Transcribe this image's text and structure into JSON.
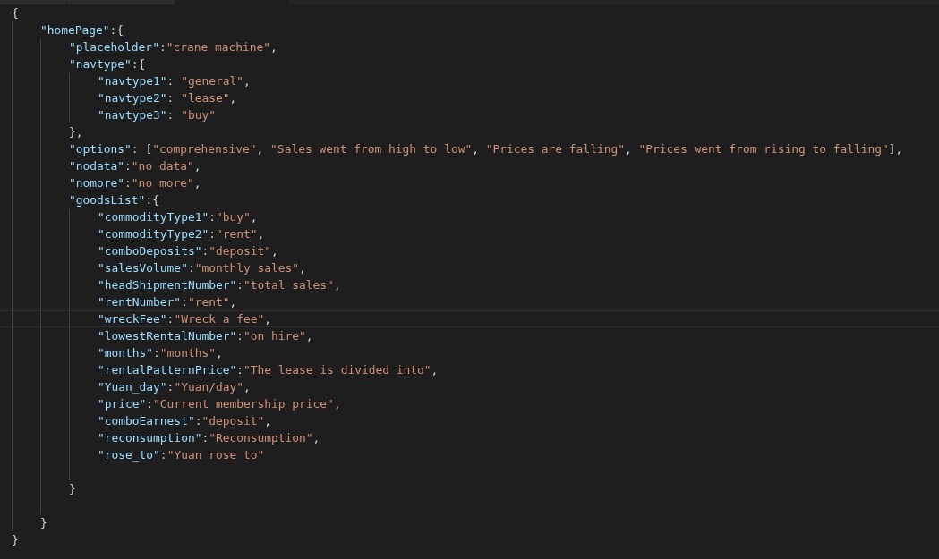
{
  "editor": {
    "lines": [
      {
        "current": false,
        "tokens": [
          {
            "kind": "punct",
            "text": "{"
          }
        ],
        "children": [
          {
            "current": false,
            "tokens": [
              {
                "kind": "key",
                "text": "\"homePage\""
              },
              {
                "kind": "punct",
                "text": ":{"
              }
            ],
            "children": [
              {
                "current": false,
                "tokens": [
                  {
                    "kind": "key",
                    "text": "\"placeholder\""
                  },
                  {
                    "kind": "punct",
                    "text": ":"
                  },
                  {
                    "kind": "str",
                    "text": "\"crane machine\""
                  },
                  {
                    "kind": "punct",
                    "text": ","
                  }
                ]
              },
              {
                "current": false,
                "tokens": [
                  {
                    "kind": "key",
                    "text": "\"navtype\""
                  },
                  {
                    "kind": "punct",
                    "text": ":{"
                  }
                ],
                "children": [
                  {
                    "current": false,
                    "tokens": [
                      {
                        "kind": "key",
                        "text": "\"navtype1\""
                      },
                      {
                        "kind": "punct",
                        "text": ": "
                      },
                      {
                        "kind": "str",
                        "text": "\"general\""
                      },
                      {
                        "kind": "punct",
                        "text": ","
                      }
                    ]
                  },
                  {
                    "current": false,
                    "tokens": [
                      {
                        "kind": "key",
                        "text": "\"navtype2\""
                      },
                      {
                        "kind": "punct",
                        "text": ": "
                      },
                      {
                        "kind": "str",
                        "text": "\"lease\""
                      },
                      {
                        "kind": "punct",
                        "text": ","
                      }
                    ]
                  },
                  {
                    "current": false,
                    "tokens": [
                      {
                        "kind": "key",
                        "text": "\"navtype3\""
                      },
                      {
                        "kind": "punct",
                        "text": ": "
                      },
                      {
                        "kind": "str",
                        "text": "\"buy\""
                      }
                    ]
                  }
                ]
              },
              {
                "current": false,
                "tokens": [
                  {
                    "kind": "punct",
                    "text": "},"
                  }
                ]
              },
              {
                "current": false,
                "tokens": [
                  {
                    "kind": "key",
                    "text": "\"options\""
                  },
                  {
                    "kind": "punct",
                    "text": ": ["
                  },
                  {
                    "kind": "str",
                    "text": "\"comprehensive\""
                  },
                  {
                    "kind": "punct",
                    "text": ", "
                  },
                  {
                    "kind": "str",
                    "text": "\"Sales went from high to low\""
                  },
                  {
                    "kind": "punct",
                    "text": ", "
                  },
                  {
                    "kind": "str",
                    "text": "\"Prices are falling\""
                  },
                  {
                    "kind": "punct",
                    "text": ", "
                  },
                  {
                    "kind": "str",
                    "text": "\"Prices went from rising to falling\""
                  },
                  {
                    "kind": "punct",
                    "text": "],"
                  }
                ]
              },
              {
                "current": false,
                "tokens": [
                  {
                    "kind": "key",
                    "text": "\"nodata\""
                  },
                  {
                    "kind": "punct",
                    "text": ":"
                  },
                  {
                    "kind": "str",
                    "text": "\"no data\""
                  },
                  {
                    "kind": "punct",
                    "text": ","
                  }
                ]
              },
              {
                "current": false,
                "tokens": [
                  {
                    "kind": "key",
                    "text": "\"nomore\""
                  },
                  {
                    "kind": "punct",
                    "text": ":"
                  },
                  {
                    "kind": "str",
                    "text": "\"no more\""
                  },
                  {
                    "kind": "punct",
                    "text": ","
                  }
                ]
              },
              {
                "current": false,
                "tokens": [
                  {
                    "kind": "key",
                    "text": "\"goodsList\""
                  },
                  {
                    "kind": "punct",
                    "text": ":{"
                  }
                ],
                "children": [
                  {
                    "current": false,
                    "tokens": [
                      {
                        "kind": "key",
                        "text": "\"commodityType1\""
                      },
                      {
                        "kind": "punct",
                        "text": ":"
                      },
                      {
                        "kind": "str",
                        "text": "\"buy\""
                      },
                      {
                        "kind": "punct",
                        "text": ","
                      }
                    ]
                  },
                  {
                    "current": false,
                    "tokens": [
                      {
                        "kind": "key",
                        "text": "\"commodityType2\""
                      },
                      {
                        "kind": "punct",
                        "text": ":"
                      },
                      {
                        "kind": "str",
                        "text": "\"rent\""
                      },
                      {
                        "kind": "punct",
                        "text": ","
                      }
                    ]
                  },
                  {
                    "current": false,
                    "tokens": [
                      {
                        "kind": "key",
                        "text": "\"comboDeposits\""
                      },
                      {
                        "kind": "punct",
                        "text": ":"
                      },
                      {
                        "kind": "str",
                        "text": "\"deposit\""
                      },
                      {
                        "kind": "punct",
                        "text": ","
                      }
                    ]
                  },
                  {
                    "current": false,
                    "tokens": [
                      {
                        "kind": "key",
                        "text": "\"salesVolume\""
                      },
                      {
                        "kind": "punct",
                        "text": ":"
                      },
                      {
                        "kind": "str",
                        "text": "\"monthly sales\""
                      },
                      {
                        "kind": "punct",
                        "text": ","
                      }
                    ]
                  },
                  {
                    "current": false,
                    "tokens": [
                      {
                        "kind": "key",
                        "text": "\"headShipmentNumber\""
                      },
                      {
                        "kind": "punct",
                        "text": ":"
                      },
                      {
                        "kind": "str",
                        "text": "\"total sales\""
                      },
                      {
                        "kind": "punct",
                        "text": ","
                      }
                    ]
                  },
                  {
                    "current": false,
                    "tokens": [
                      {
                        "kind": "key",
                        "text": "\"rentNumber\""
                      },
                      {
                        "kind": "punct",
                        "text": ":"
                      },
                      {
                        "kind": "str",
                        "text": "\"rent\""
                      },
                      {
                        "kind": "punct",
                        "text": ","
                      }
                    ]
                  },
                  {
                    "current": true,
                    "tokens": [
                      {
                        "kind": "key",
                        "text": "\"wreckFee\""
                      },
                      {
                        "kind": "punct",
                        "text": ":"
                      },
                      {
                        "kind": "str",
                        "text": "\"Wreck a fee\""
                      },
                      {
                        "kind": "punct",
                        "text": ","
                      }
                    ]
                  },
                  {
                    "current": false,
                    "tokens": [
                      {
                        "kind": "key",
                        "text": "\"lowestRentalNumber\""
                      },
                      {
                        "kind": "punct",
                        "text": ":"
                      },
                      {
                        "kind": "str",
                        "text": "\"on hire\""
                      },
                      {
                        "kind": "punct",
                        "text": ","
                      }
                    ]
                  },
                  {
                    "current": false,
                    "tokens": [
                      {
                        "kind": "key",
                        "text": "\"months\""
                      },
                      {
                        "kind": "punct",
                        "text": ":"
                      },
                      {
                        "kind": "str",
                        "text": "\"months\""
                      },
                      {
                        "kind": "punct",
                        "text": ","
                      }
                    ]
                  },
                  {
                    "current": false,
                    "tokens": [
                      {
                        "kind": "key",
                        "text": "\"rentalPatternPrice\""
                      },
                      {
                        "kind": "punct",
                        "text": ":"
                      },
                      {
                        "kind": "str",
                        "text": "\"The lease is divided into\""
                      },
                      {
                        "kind": "punct",
                        "text": ","
                      }
                    ]
                  },
                  {
                    "current": false,
                    "tokens": [
                      {
                        "kind": "key",
                        "text": "\"Yuan_day\""
                      },
                      {
                        "kind": "punct",
                        "text": ":"
                      },
                      {
                        "kind": "str",
                        "text": "\"Yuan/day\""
                      },
                      {
                        "kind": "punct",
                        "text": ","
                      }
                    ]
                  },
                  {
                    "current": false,
                    "tokens": [
                      {
                        "kind": "key",
                        "text": "\"price\""
                      },
                      {
                        "kind": "punct",
                        "text": ":"
                      },
                      {
                        "kind": "str",
                        "text": "\"Current membership price\""
                      },
                      {
                        "kind": "punct",
                        "text": ","
                      }
                    ]
                  },
                  {
                    "current": false,
                    "tokens": [
                      {
                        "kind": "key",
                        "text": "\"comboEarnest\""
                      },
                      {
                        "kind": "punct",
                        "text": ":"
                      },
                      {
                        "kind": "str",
                        "text": "\"deposit\""
                      },
                      {
                        "kind": "punct",
                        "text": ","
                      }
                    ]
                  },
                  {
                    "current": false,
                    "tokens": [
                      {
                        "kind": "key",
                        "text": "\"reconsumption\""
                      },
                      {
                        "kind": "punct",
                        "text": ":"
                      },
                      {
                        "kind": "str",
                        "text": "\"Reconsumption\""
                      },
                      {
                        "kind": "punct",
                        "text": ","
                      }
                    ]
                  },
                  {
                    "current": false,
                    "tokens": [
                      {
                        "kind": "key",
                        "text": "\"rose_to\""
                      },
                      {
                        "kind": "punct",
                        "text": ":"
                      },
                      {
                        "kind": "str",
                        "text": "\"Yuan rose to\""
                      }
                    ]
                  },
                  {
                    "current": false
                  }
                ]
              },
              {
                "current": false,
                "tokens": [
                  {
                    "kind": "punct",
                    "text": "}"
                  }
                ]
              },
              {
                "current": false
              }
            ]
          },
          {
            "current": false,
            "tokens": [
              {
                "kind": "punct",
                "text": "}"
              }
            ]
          }
        ]
      },
      {
        "current": false,
        "tokens": [
          {
            "kind": "punct",
            "text": "}"
          }
        ]
      }
    ]
  }
}
